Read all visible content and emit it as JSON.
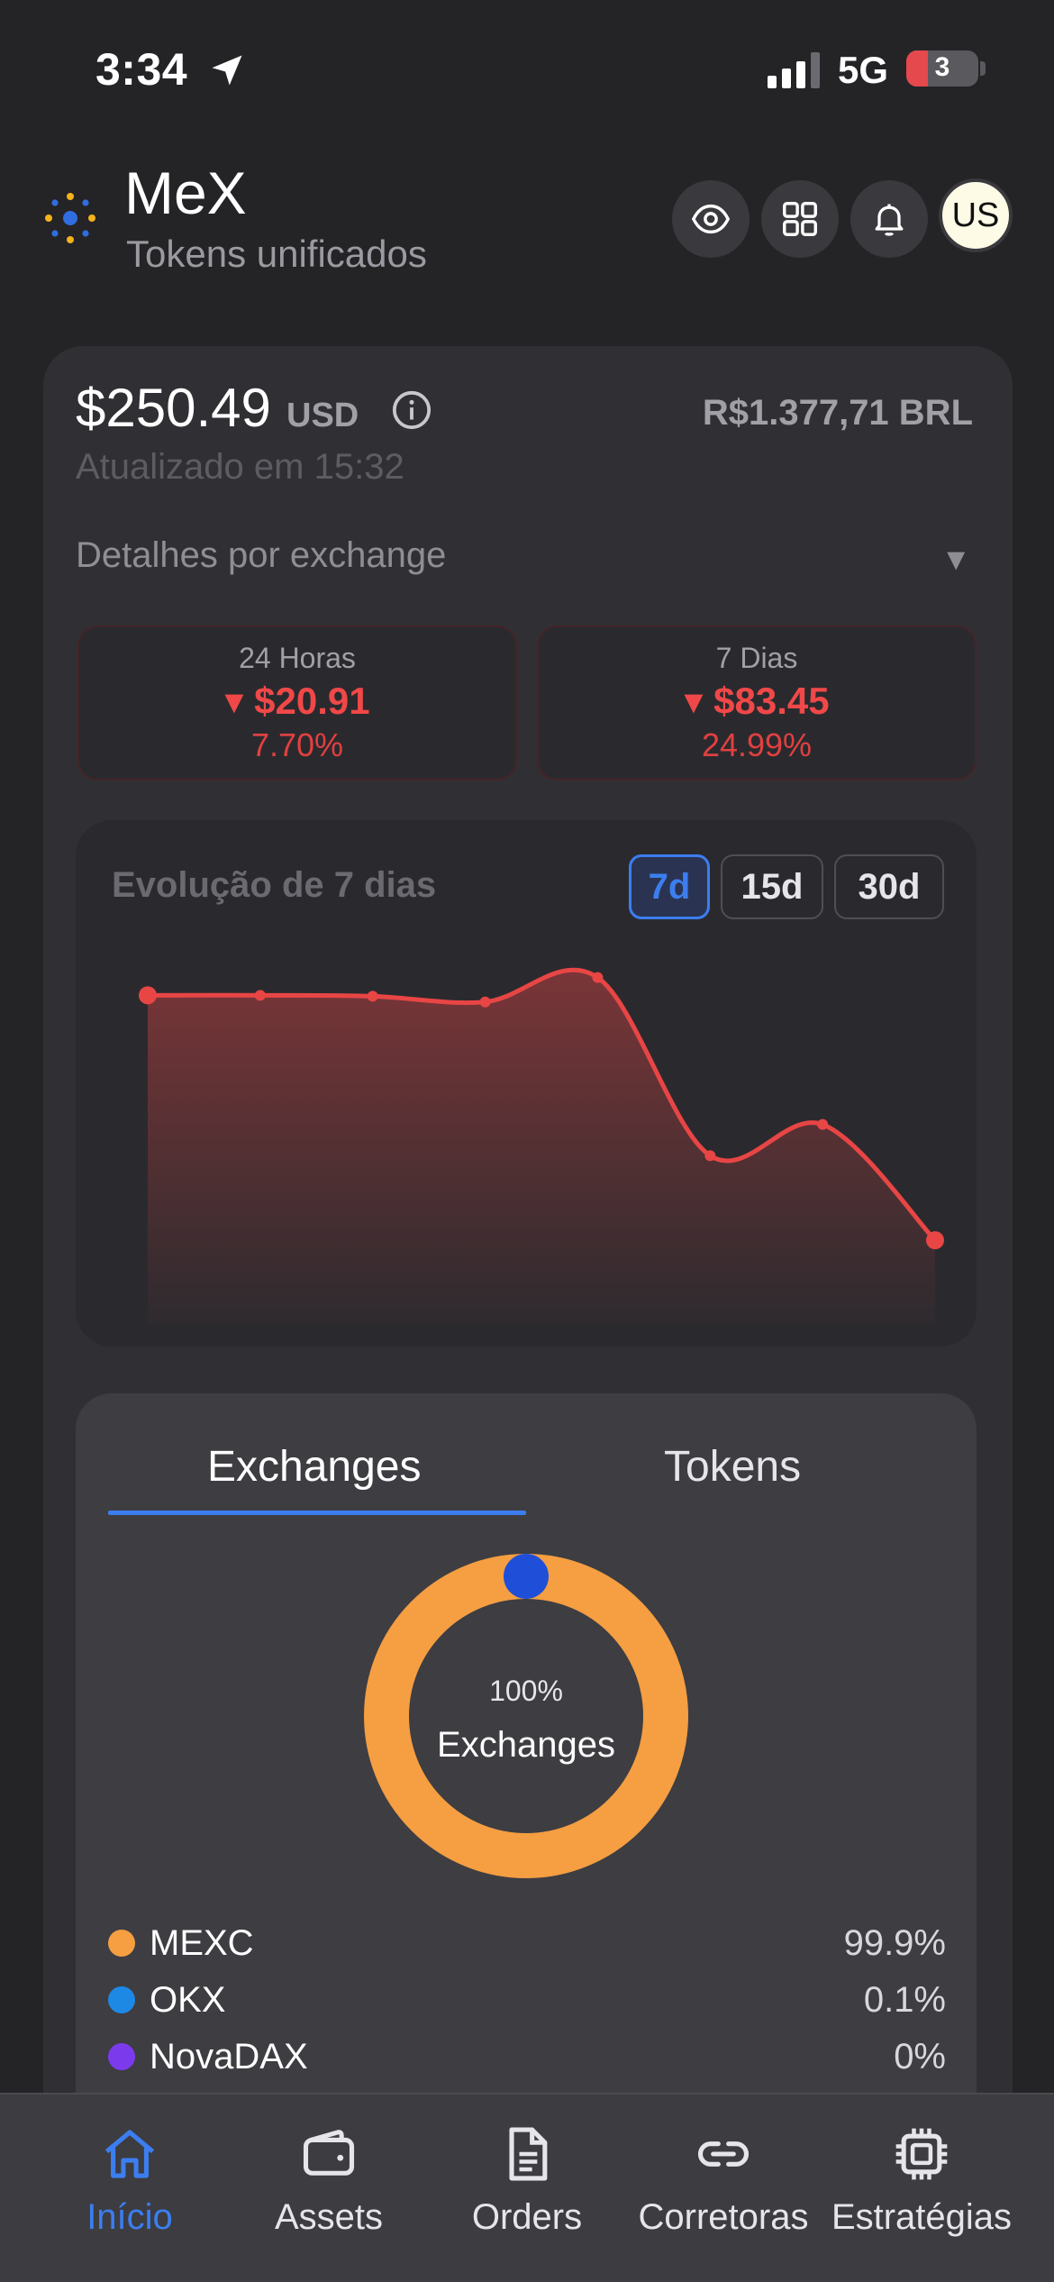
{
  "status_bar": {
    "time": "3:34",
    "network": "5G",
    "battery": "3",
    "battery_fraction": 0.3
  },
  "header": {
    "app_name": "MeX",
    "subtitle": "Tokens unificados",
    "avatar_initials": "US",
    "icons": [
      "eye-icon",
      "grid-icon",
      "bell-icon"
    ]
  },
  "balance": {
    "amount": "$250.49",
    "currency": "USD",
    "brl": "R$1.377,71 BRL",
    "updated": "Atualizado em 15:32",
    "details_label": "Detalhes por exchange",
    "caret": "▼"
  },
  "stats": [
    {
      "label": "24 Horas",
      "value": "▾ $20.91",
      "percent": "7.70%"
    },
    {
      "label": "7 Dias",
      "value": "▾ $83.45",
      "percent": "24.99%"
    }
  ],
  "chart_card": {
    "title": "Evolução de 7 dias",
    "ranges": [
      "7d",
      "15d",
      "30d"
    ],
    "active_range": "7d"
  },
  "chart_data": {
    "type": "area",
    "x": [
      1,
      2,
      3,
      4,
      5,
      6,
      7,
      8
    ],
    "values": [
      334,
      334,
      333.8,
      332.5,
      338,
      298,
      305,
      279
    ],
    "ylim": [
      260,
      345
    ],
    "color": "#e84545",
    "grid": false,
    "legend": "none"
  },
  "distribution": {
    "tabs": [
      "Exchanges",
      "Tokens"
    ],
    "active_tab": "Exchanges",
    "donut_percent": "100%",
    "donut_label": "Exchanges",
    "items": [
      {
        "name": "MEXC",
        "percent": "99.9%",
        "value": 99.9,
        "color": "#f59e42"
      },
      {
        "name": "OKX",
        "percent": "0.1%",
        "value": 0.1,
        "color": "#1e88e5"
      },
      {
        "name": "NovaDAX",
        "percent": "0%",
        "value": 0,
        "color": "#7c3aed"
      }
    ]
  },
  "bottom_nav": [
    {
      "label": "Início",
      "icon": "home-icon",
      "active": true
    },
    {
      "label": "Assets",
      "icon": "wallet-icon",
      "active": false
    },
    {
      "label": "Orders",
      "icon": "document-icon",
      "active": false
    },
    {
      "label": "Corretoras",
      "icon": "link-icon",
      "active": false
    },
    {
      "label": "Estratégias",
      "icon": "chip-icon",
      "active": false
    }
  ],
  "colors": {
    "accent": "#3c7ef0",
    "negative": "#f04848",
    "donut_dot": "#1f4fd8"
  }
}
